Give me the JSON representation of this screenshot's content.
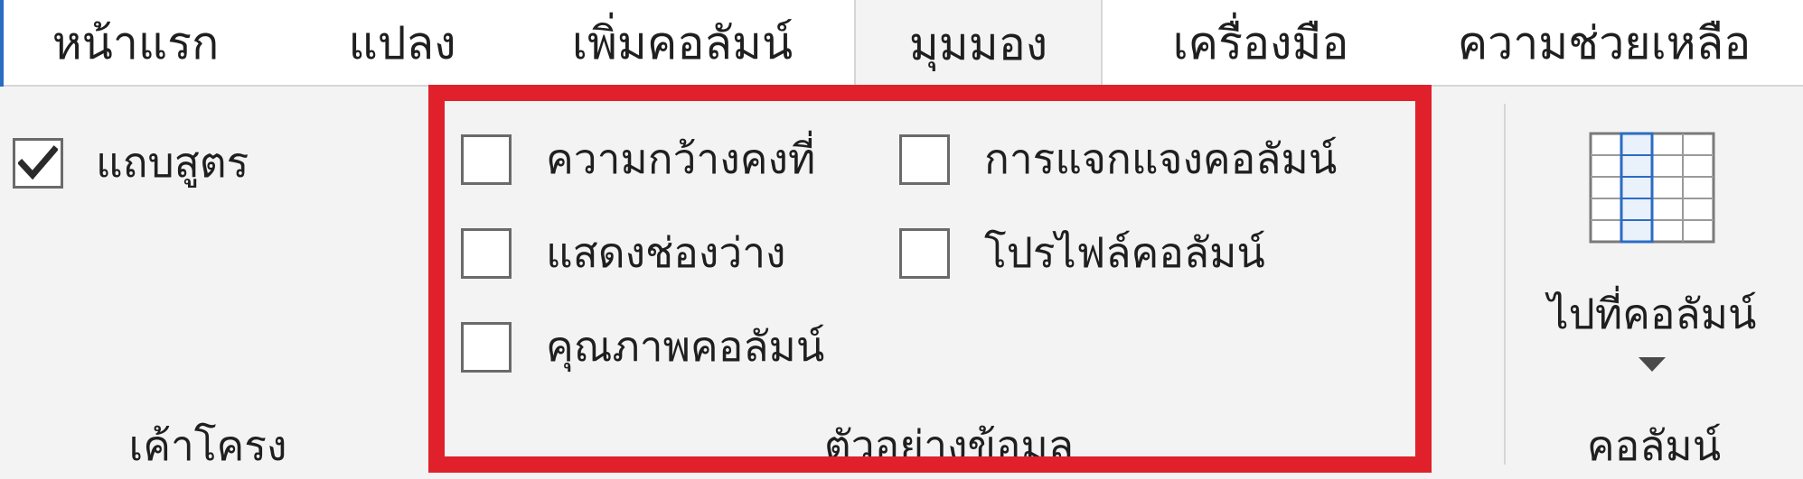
{
  "tabs": [
    {
      "label": "หน้าแรก",
      "active": false
    },
    {
      "label": "แปลง",
      "active": false
    },
    {
      "label": "เพิ่มคอลัมน์",
      "active": false
    },
    {
      "label": "มุมมอง",
      "active": true
    },
    {
      "label": "เครื่องมือ",
      "active": false
    },
    {
      "label": "ความช่วยเหลือ",
      "active": false
    }
  ],
  "layout_group": {
    "title": "เค้าโครง",
    "formula_bar": {
      "label": "แถบสูตร",
      "checked": true
    }
  },
  "data_preview_group": {
    "title": "ตัวอย่างข้อมูล",
    "options": [
      {
        "label": "ความกว้างคงที่",
        "checked": false
      },
      {
        "label": "การแจกแจงคอลัมน์",
        "checked": false
      },
      {
        "label": "แสดงช่องว่าง",
        "checked": false
      },
      {
        "label": "โปรไฟล์คอลัมน์",
        "checked": false
      },
      {
        "label": "คุณภาพคอลัมน์",
        "checked": false
      }
    ]
  },
  "columns_group": {
    "title": "คอลัมน์",
    "go_to_column": {
      "label": "ไปที่คอลัมน์",
      "icon": "go-to-column-icon"
    }
  },
  "colors": {
    "highlight": "#e0212b",
    "accent": "#2b6cc4"
  }
}
